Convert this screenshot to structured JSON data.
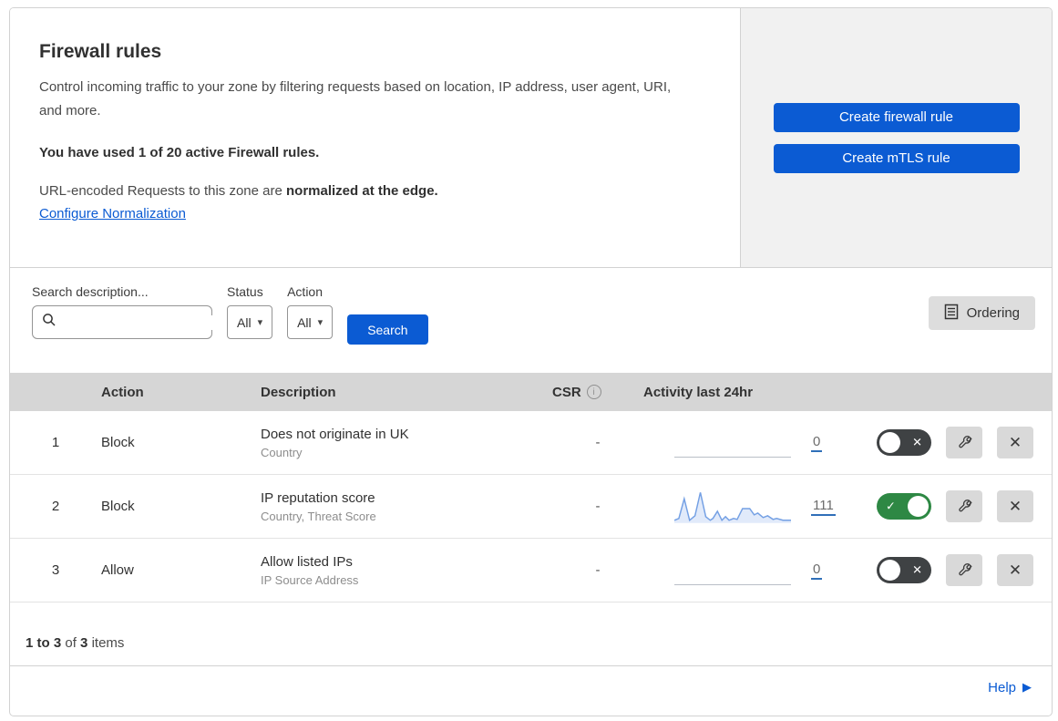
{
  "header": {
    "title": "Firewall rules",
    "description": "Control incoming traffic to your zone by filtering requests based on location, IP address, user agent, URI, and more.",
    "usage": "You have used 1 of 20 active Firewall rules.",
    "normalization_prefix": "URL-encoded Requests to this zone are ",
    "normalization_bold": "normalized at the edge.",
    "configure_link": "Configure Normalization",
    "create_firewall_button": "Create firewall rule",
    "create_mtls_button": "Create mTLS rule"
  },
  "filters": {
    "search_label": "Search description...",
    "status_label": "Status",
    "status_value": "All",
    "action_label": "Action",
    "action_value": "All",
    "search_button": "Search",
    "ordering_button": "Ordering"
  },
  "table": {
    "columns": {
      "action": "Action",
      "description": "Description",
      "csr": "CSR",
      "activity": "Activity last 24hr"
    },
    "rows": [
      {
        "index": "1",
        "action": "Block",
        "description": "Does not originate in UK",
        "criteria": "Country",
        "csr": "-",
        "activity_count": "0",
        "enabled": false
      },
      {
        "index": "2",
        "action": "Block",
        "description": "IP reputation score",
        "criteria": "Country, Threat Score",
        "csr": "-",
        "activity_count": "111",
        "enabled": true,
        "sparkline": {
          "points": [
            [
              0,
              33
            ],
            [
              5,
              31
            ],
            [
              11,
              9
            ],
            [
              17,
              33
            ],
            [
              23,
              28
            ],
            [
              29,
              2
            ],
            [
              35,
              29
            ],
            [
              40,
              33
            ],
            [
              43,
              31
            ],
            [
              48,
              23
            ],
            [
              53,
              33
            ],
            [
              57,
              29
            ],
            [
              61,
              33
            ],
            [
              66,
              31
            ],
            [
              70,
              32
            ],
            [
              76,
              20
            ],
            [
              84,
              20
            ],
            [
              89,
              27
            ],
            [
              93,
              25
            ],
            [
              99,
              30
            ],
            [
              104,
              28
            ],
            [
              110,
              32
            ],
            [
              114,
              31
            ],
            [
              121,
              33
            ],
            [
              130,
              33
            ]
          ],
          "stroke": "#74a0e4",
          "fill": "#e1eafa"
        }
      },
      {
        "index": "3",
        "action": "Allow",
        "description": "Allow listed IPs",
        "criteria": "IP Source Address",
        "csr": "-",
        "activity_count": "0",
        "enabled": false
      }
    ]
  },
  "footer": {
    "range": "1 to 3",
    "of_word": "of",
    "total": "3",
    "items_word": "items",
    "help_label": "Help"
  },
  "icons": {
    "dropdown_glyph": "▾",
    "info_glyph": "i",
    "toggle_cross_glyph": "✕",
    "toggle_check_glyph": "✓",
    "close_glyph": "✕",
    "help_arrow_glyph": "▶"
  },
  "colors": {
    "primary_blue": "#0b5bd3",
    "toggle_on_green": "#2e8844",
    "toggle_off_gray": "#3f4244",
    "panel_gray": "#f1f1f1",
    "table_header_gray": "#d6d6d6",
    "sparkline_blue": "#74a0e4"
  }
}
